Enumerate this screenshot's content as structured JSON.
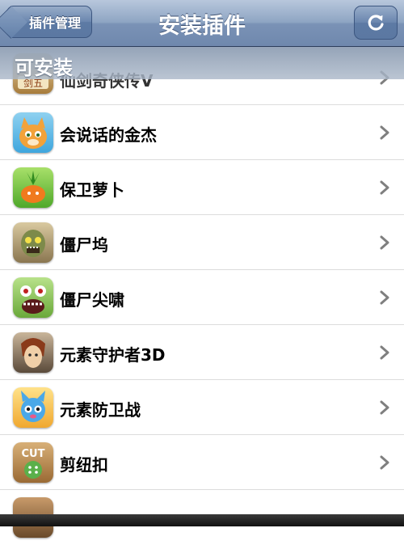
{
  "navbar": {
    "back_label": "插件管理",
    "title": "安装插件",
    "refresh_icon": "refresh-icon"
  },
  "section": {
    "title": "可安装"
  },
  "items": [
    {
      "label": "仙剑奇侠传Ⅴ",
      "icon": "sword-game-icon"
    },
    {
      "label": "会说话的金杰",
      "icon": "talking-cat-icon"
    },
    {
      "label": "保卫萝卜",
      "icon": "carrot-icon"
    },
    {
      "label": "僵尸坞",
      "icon": "zombie-icon"
    },
    {
      "label": "僵尸尖啸",
      "icon": "screaming-zombie-icon"
    },
    {
      "label": "元素守护者3D",
      "icon": "guardian-icon"
    },
    {
      "label": "元素防卫战",
      "icon": "blue-creature-icon"
    },
    {
      "label": "剪纽扣",
      "icon": "cut-button-icon"
    }
  ],
  "colors": {
    "navbar": "#7a92b6",
    "separator": "#dcdcdc",
    "chevron": "#7f7f7f"
  }
}
